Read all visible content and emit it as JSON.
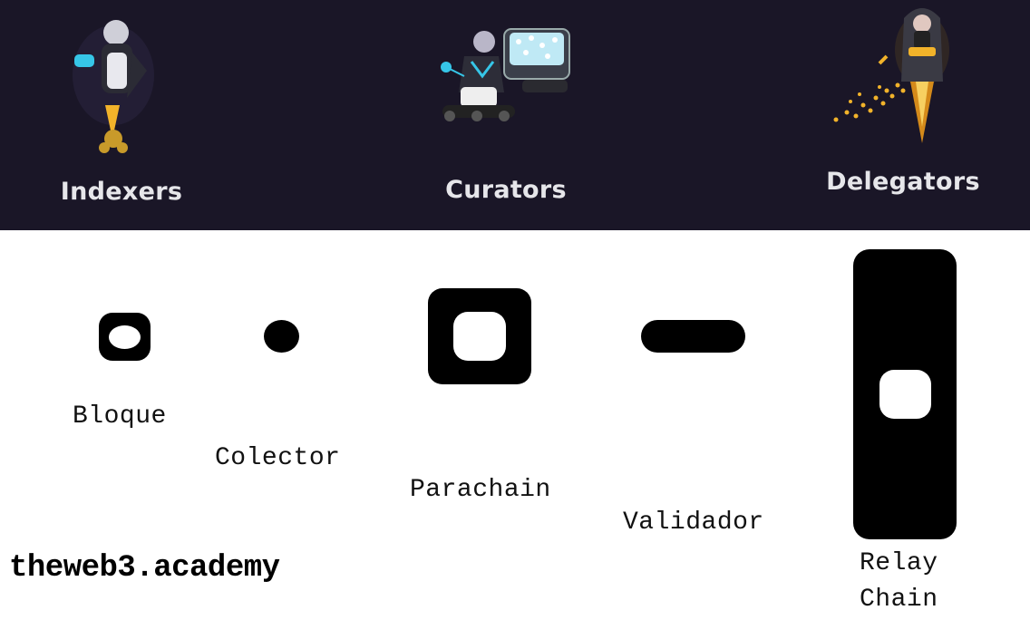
{
  "header": {
    "roles": [
      {
        "label": "Indexers",
        "icon": "indexer-illustration-icon"
      },
      {
        "label": "Curators",
        "icon": "curator-illustration-icon"
      },
      {
        "label": "Delegators",
        "icon": "delegator-illustration-icon"
      }
    ]
  },
  "legend": {
    "items": [
      {
        "label": "Bloque",
        "icon": "block-icon"
      },
      {
        "label": "Colector",
        "icon": "collator-icon"
      },
      {
        "label": "Parachain",
        "icon": "parachain-icon"
      },
      {
        "label": "Validador",
        "icon": "validator-icon"
      },
      {
        "label": "Relay\nChain",
        "icon": "relay-chain-icon"
      }
    ]
  },
  "brand": "theweb3.academy",
  "colors": {
    "header_bg": "#1a1627",
    "accent_gold": "#f2b32a",
    "accent_cyan": "#36c6e8"
  }
}
